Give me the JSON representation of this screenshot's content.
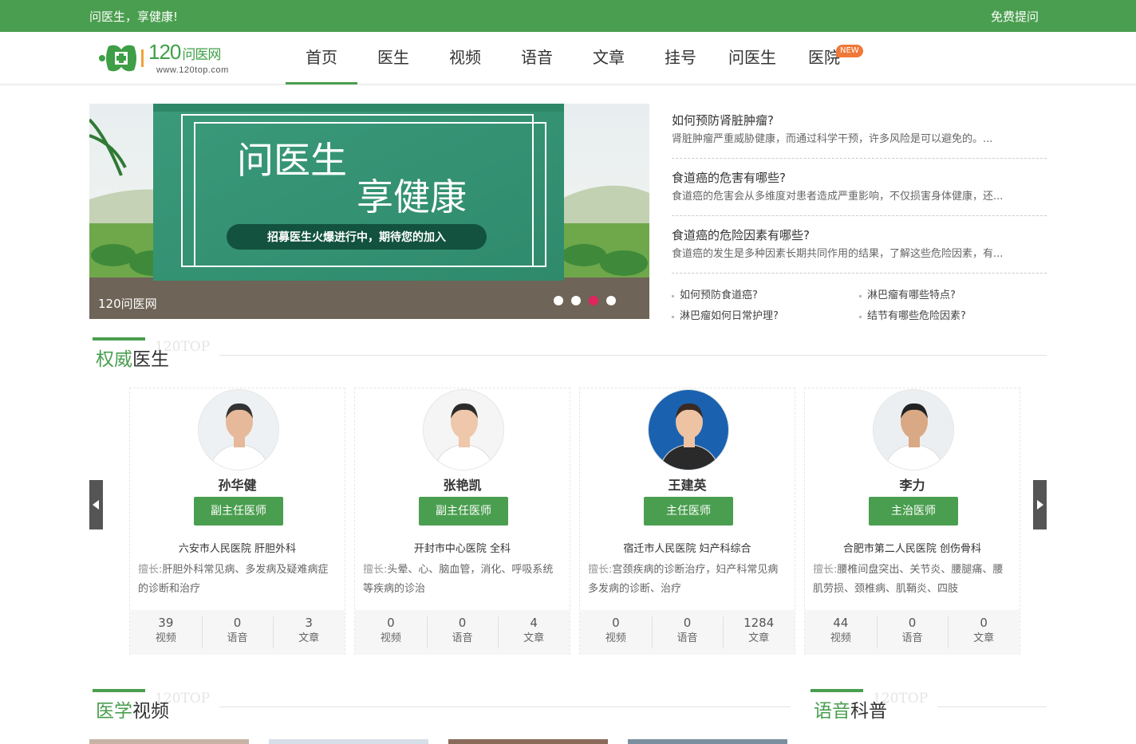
{
  "topbar": {
    "slogan": "问医生，享健康!",
    "ask_link": "免费提问"
  },
  "logo": {
    "brand_num": "120",
    "brand_text": "问医网",
    "url": "www.120top.com"
  },
  "nav": {
    "items": [
      {
        "label": "首页",
        "active": true
      },
      {
        "label": "医生"
      },
      {
        "label": "视频"
      },
      {
        "label": "语音"
      },
      {
        "label": "文章"
      },
      {
        "label": "挂号"
      },
      {
        "label": "问医生"
      },
      {
        "label": "医院",
        "badge": "NEW"
      }
    ]
  },
  "banner": {
    "line1": "问医生",
    "line2": "享健康",
    "pill": "招募医生火爆进行中，期待您的加入",
    "caption": "120问医网",
    "dots": 4,
    "active_dot": 3
  },
  "news": {
    "items": [
      {
        "title": "如何预防肾脏肿瘤?",
        "desc": "肾脏肿瘤严重威胁健康，而通过科学干预，许多风险是可以避免的。..."
      },
      {
        "title": "食道癌的危害有哪些?",
        "desc": "食道癌的危害会从多维度对患者造成严重影响，不仅损害身体健康，还..."
      },
      {
        "title": "食道癌的危险因素有哪些?",
        "desc": "食道癌的发生是多种因素长期共同作用的结果，了解这些危险因素，有..."
      }
    ],
    "links": [
      "如何预防食道癌?",
      "淋巴瘤有哪些特点?",
      "淋巴瘤如何日常护理?",
      "结节有哪些危险因素?"
    ]
  },
  "sections": {
    "doctors": {
      "hl": "权威",
      "rest": "医生",
      "watermark": "120TOP"
    },
    "videos": {
      "hl": "医学",
      "rest": "视频",
      "watermark": "120TOP"
    },
    "audio": {
      "hl": "语音",
      "rest": "科普",
      "watermark": "120TOP"
    }
  },
  "doctors": [
    {
      "name": "孙华健",
      "title": "副主任医师",
      "hospital": "六安市人民医院 肝胆外科",
      "skill_label": "擅长:",
      "skill": "肝胆外科常见病、多发病及疑难病症的诊断和治疗",
      "stats": [
        {
          "num": "39",
          "label": "视频"
        },
        {
          "num": "0",
          "label": "语音"
        },
        {
          "num": "3",
          "label": "文章"
        }
      ]
    },
    {
      "name": "张艳凯",
      "title": "副主任医师",
      "hospital": "开封市中心医院 全科",
      "skill_label": "擅长:",
      "skill": "头晕、心、脑血管，消化、呼吸系统等疾病的诊治",
      "stats": [
        {
          "num": "0",
          "label": "视频"
        },
        {
          "num": "0",
          "label": "语音"
        },
        {
          "num": "4",
          "label": "文章"
        }
      ]
    },
    {
      "name": "王建英",
      "title": "主任医师",
      "hospital": "宿迁市人民医院 妇产科综合",
      "skill_label": "擅长:",
      "skill": "宫颈疾病的诊断治疗，妇产科常见病多发病的诊断、治疗",
      "stats": [
        {
          "num": "0",
          "label": "视频"
        },
        {
          "num": "0",
          "label": "语音"
        },
        {
          "num": "1284",
          "label": "文章"
        }
      ]
    },
    {
      "name": "李力",
      "title": "主治医师",
      "hospital": "合肥市第二人民医院 创伤骨科",
      "skill_label": "擅长:",
      "skill": "腰椎间盘突出、关节炎、腰腿痛、腰肌劳损、颈椎病、肌鞘炎、四肢",
      "stats": [
        {
          "num": "44",
          "label": "视频"
        },
        {
          "num": "0",
          "label": "语音"
        },
        {
          "num": "0",
          "label": "文章"
        }
      ]
    }
  ],
  "colors": {
    "brand": "#4a9e4f",
    "badge": "#f0783a"
  }
}
